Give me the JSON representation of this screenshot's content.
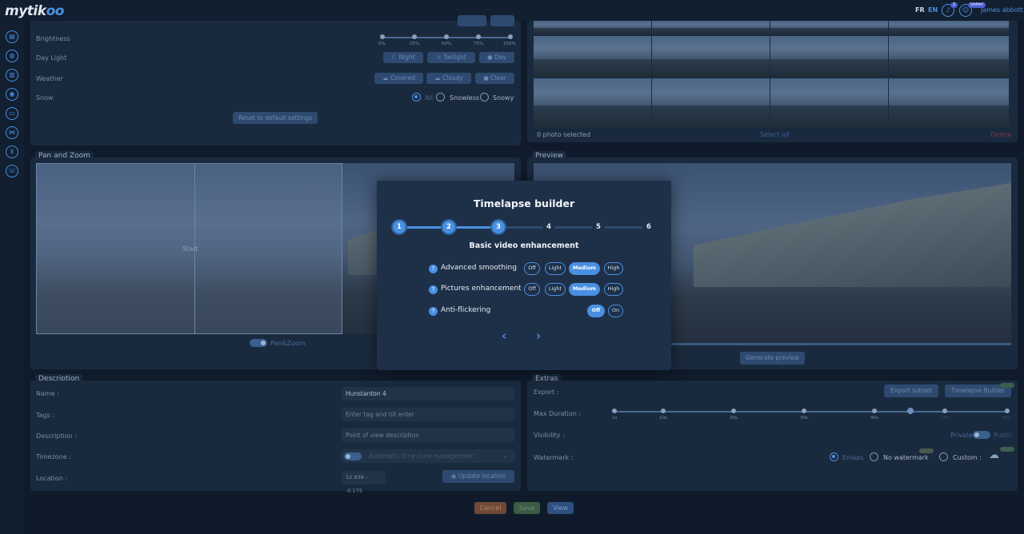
{
  "brand": {
    "logo_prefix": "my",
    "logo_main": "tik",
    "logo_suffix": "oo"
  },
  "topbar": {
    "lang_fr": "FR",
    "lang_en": "EN",
    "notif_count": "2",
    "user_badge": "Unlim!",
    "user_name": "James abbott"
  },
  "filters": {
    "brightness_label": "Brightness",
    "brightness_ticks": [
      "0%",
      "25%",
      "50%",
      "75%",
      "100%"
    ],
    "daylight_label": "Day Light",
    "daylight_options": [
      "Night",
      "Twilight",
      "Day"
    ],
    "weather_label": "Weather",
    "weather_options": [
      "Covered",
      "Cloudy",
      "Clear"
    ],
    "snow_label": "Snow",
    "snow_options": [
      "All",
      "Snowless",
      "Snowy"
    ],
    "reset_label": "Reset to default settings"
  },
  "gallery": {
    "selected_text": "0 photo selected",
    "select_all": "Select all",
    "delete": "Delete"
  },
  "panzoom": {
    "title": "Pan and Zoom",
    "start_label": "Start",
    "toggle_label": "Pan&Zoom"
  },
  "preview": {
    "title": "Preview",
    "generate_label": "Generate preview"
  },
  "description": {
    "title": "Description",
    "name_label": "Name :",
    "name_value": "Hunstanton 4",
    "tags_label": "Tags :",
    "tags_placeholder": "Enter tag and hit enter",
    "desc_label": "Description :",
    "desc_placeholder": "Point of view description",
    "timezone_label": "Timezone :",
    "timezone_value": "Automatic time zone management",
    "location_label": "Location :",
    "location_value": "52.939 - -0.175",
    "update_location": "Update location"
  },
  "extras": {
    "title": "Extras",
    "export_label": "Export :",
    "export_subset": "Export subset",
    "timelapse_builder": "Timelapse Builder",
    "duration_label": "Max Duration :",
    "duration_ticks": [
      "1s",
      "10s",
      "20s",
      "30s",
      "40s",
      "50s",
      "60s"
    ],
    "visibility_label": "Visibility :",
    "private": "Private",
    "public": "Public",
    "watermark_label": "Watermark :",
    "watermark_options": [
      "Enlaps",
      "No watermark",
      "Custom :"
    ]
  },
  "footer": {
    "cancel": "Cancel",
    "save": "Save",
    "view": "View"
  },
  "modal": {
    "title": "Timelapse builder",
    "steps": [
      "1",
      "2",
      "3",
      "4",
      "5",
      "6"
    ],
    "current_step": 3,
    "subtitle": "Basic video enhancement",
    "q": "?",
    "rows": [
      {
        "label": "Advanced smoothing",
        "options": [
          "Off",
          "Light",
          "Medium",
          "High"
        ],
        "selected": "Medium"
      },
      {
        "label": "Pictures enhancement",
        "options": [
          "Off",
          "Light",
          "Medium",
          "High"
        ],
        "selected": "Medium"
      },
      {
        "label": "Anti-flickering",
        "options": [
          "Off",
          "On"
        ],
        "selected": "Off"
      }
    ],
    "prev": "‹",
    "next": "›"
  },
  "colors": {
    "accent": "#4a90e2",
    "background": "#0f1b2b",
    "panel": "#1a2a3e",
    "modal": "#1e3048"
  }
}
